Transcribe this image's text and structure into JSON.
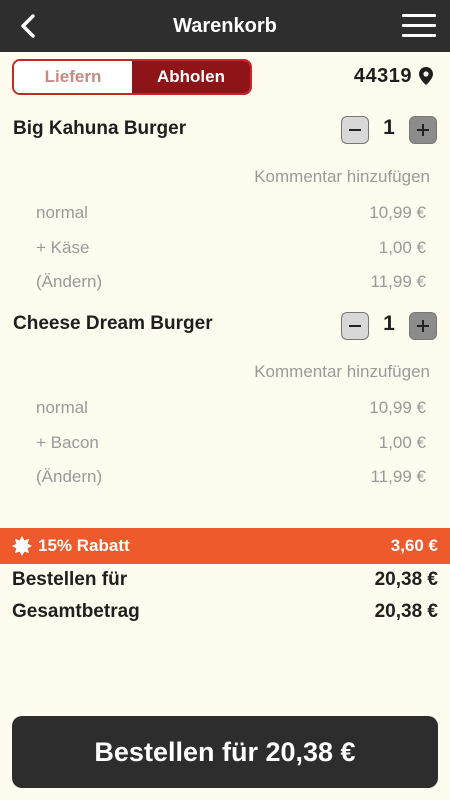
{
  "header": {
    "title": "Warenkorb",
    "back_icon": "chevron-left-icon",
    "menu_icon": "hamburger-menu-icon"
  },
  "delivery_toggle": {
    "options": [
      {
        "label": "Liefern",
        "selected": false
      },
      {
        "label": "Abholen",
        "selected": true
      }
    ]
  },
  "location": {
    "zip": "44319",
    "icon": "location-pin-icon"
  },
  "cart_items": [
    {
      "name": "Big Kahuna Burger",
      "quantity": "1",
      "comment_label": "Kommentar hinzufügen",
      "options": [
        {
          "label": "normal",
          "price": "10,99 €"
        },
        {
          "label": "+ Käse",
          "price": "1,00 €"
        },
        {
          "label": "(Ändern)",
          "price": "11,99 €"
        }
      ]
    },
    {
      "name": "Cheese Dream Burger",
      "quantity": "1",
      "comment_label": "Kommentar hinzufügen",
      "options": [
        {
          "label": "normal",
          "price": "10,99 €"
        },
        {
          "label": "+ Bacon",
          "price": "1,00 €"
        },
        {
          "label": "(Ändern)",
          "price": "11,99 €"
        }
      ]
    }
  ],
  "discount": {
    "label": "15% Rabatt",
    "amount": "3,60 €",
    "icon": "badge-star-icon"
  },
  "totals": [
    {
      "label": "Bestellen für",
      "value": "20,38 €"
    },
    {
      "label": "Gesamtbetrag",
      "value": "20,38 €"
    }
  ],
  "order_button": {
    "label": "Bestellen für 20,38 €"
  },
  "colors": {
    "background": "#fdfcee",
    "header": "#2e2e2e",
    "accent_red": "#8f1418",
    "discount_orange": "#ee5a2c",
    "muted_text": "#9a9a9a"
  }
}
